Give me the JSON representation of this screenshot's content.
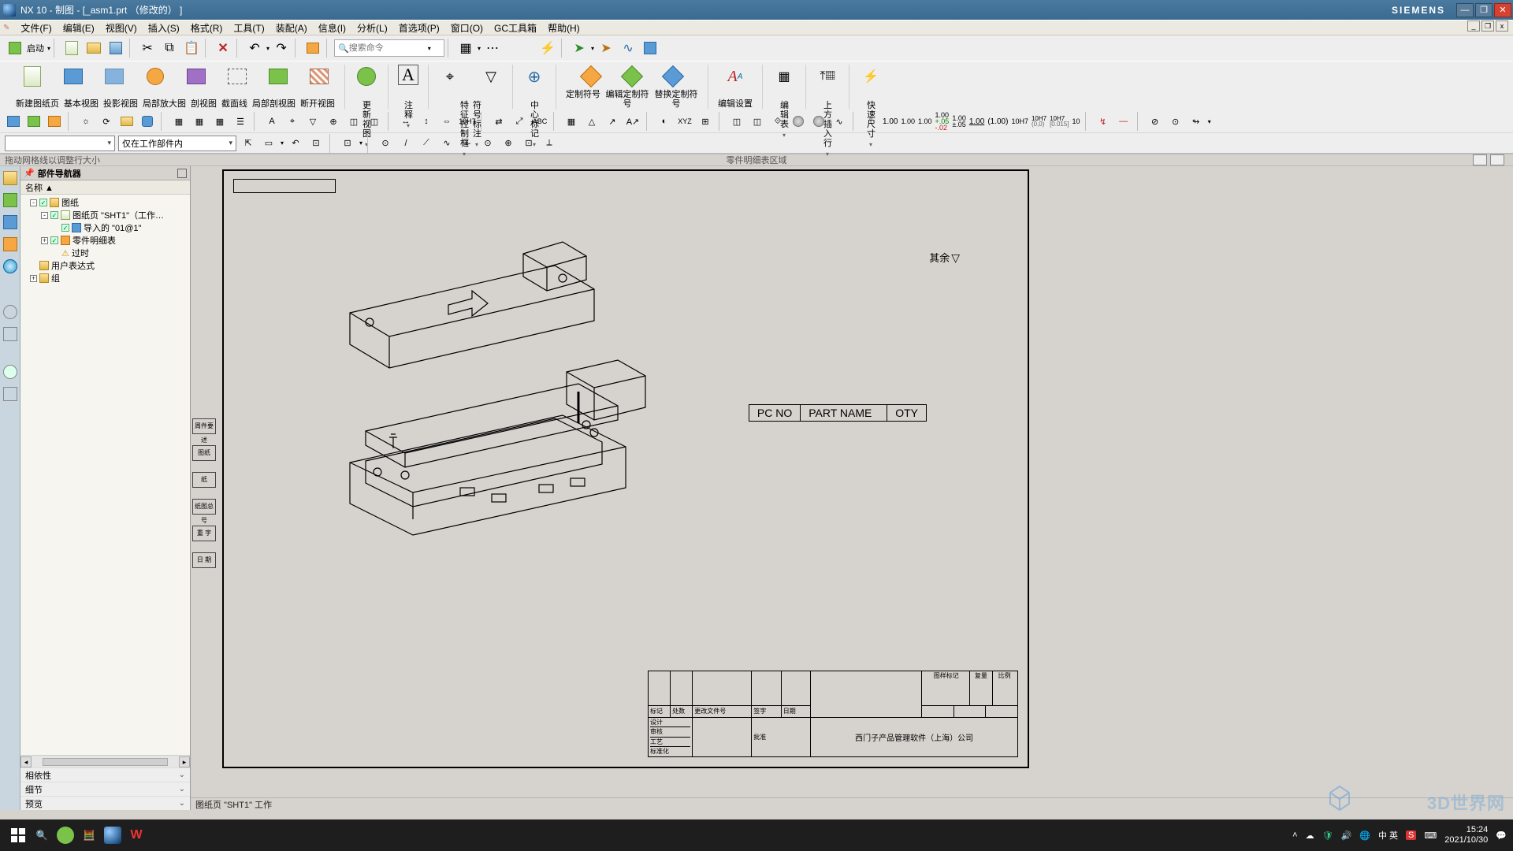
{
  "window": {
    "title": "NX 10 - 制图 - [_asm1.prt （修改的） ]",
    "brand": "SIEMENS"
  },
  "menu": {
    "items": [
      "文件(F)",
      "编辑(E)",
      "视图(V)",
      "插入(S)",
      "格式(R)",
      "工具(T)",
      "装配(A)",
      "信息(I)",
      "分析(L)",
      "首选项(P)",
      "窗口(O)",
      "GC工具箱",
      "帮助(H)"
    ]
  },
  "toolbar1": {
    "start": "启动",
    "searchPlaceholder": "搜索命令"
  },
  "ribbon": {
    "groups": [
      {
        "items": [
          {
            "icon": "new-sheet",
            "label": "新建图纸页"
          },
          {
            "icon": "base-view",
            "label": "基本视图"
          },
          {
            "icon": "proj-view",
            "label": "投影视图"
          },
          {
            "icon": "detail-view",
            "label": "局部放大图"
          },
          {
            "icon": "section-view",
            "label": "剖视图"
          },
          {
            "icon": "section-line",
            "label": "截面线"
          },
          {
            "icon": "local-section",
            "label": "局部剖视图"
          },
          {
            "icon": "break-view",
            "label": "断开视图"
          }
        ]
      },
      {
        "items": [
          {
            "icon": "update-view",
            "label": "更新视图",
            "drop": true
          }
        ]
      },
      {
        "items": [
          {
            "icon": "note",
            "label": "注释",
            "drop": true
          }
        ]
      },
      {
        "items": [
          {
            "icon": "feature-ctrl",
            "label": "特征控制框",
            "drop": true
          },
          {
            "icon": "symbol",
            "label": "符号标注",
            "drop": true
          }
        ]
      },
      {
        "items": [
          {
            "icon": "center-mark",
            "label": "中心标记",
            "drop": true
          }
        ]
      },
      {
        "items": [
          {
            "icon": "custom-sym",
            "label": "定制符号"
          },
          {
            "icon": "edit-custom",
            "label": "编辑定制符号"
          },
          {
            "icon": "swap-custom",
            "label": "替换定制符号"
          }
        ]
      },
      {
        "items": [
          {
            "icon": "edit-settings",
            "label": "编辑设置"
          }
        ]
      },
      {
        "items": [
          {
            "icon": "edit-table",
            "label": "编辑表",
            "drop": true
          }
        ]
      },
      {
        "items": [
          {
            "icon": "insert-above",
            "label": "上方插入行",
            "drop": true
          }
        ]
      },
      {
        "items": [
          {
            "icon": "quick-dim",
            "label": "快速尺寸",
            "drop": true
          }
        ]
      }
    ]
  },
  "toolRow3": {
    "textLabels": [
      "1.00",
      "10H7",
      "ABC",
      "XYZ",
      "1.00",
      "1.00",
      "1.00",
      "1.00",
      "1.00",
      "1.00",
      "(1.00)",
      "10H7",
      "10H7",
      "10H7",
      "10"
    ]
  },
  "toolRow4": {
    "combo1": "",
    "combo2": "仅在工作部件内"
  },
  "grip": {
    "left": "拖动网格线以调整行大小",
    "center": "零件明细表区域"
  },
  "navigator": {
    "title": "部件导航器",
    "colhdr": "名称    ▲",
    "tree": [
      {
        "level": 1,
        "pm": "-",
        "chk": true,
        "icon": "folder",
        "label": "图纸"
      },
      {
        "level": 2,
        "pm": "-",
        "chk": true,
        "icon": "sheet",
        "label": "图纸页 \"SHT1\"（工作…"
      },
      {
        "level": 3,
        "pm": "",
        "chk": true,
        "icon": "import",
        "label": "导入的 \"01@1\""
      },
      {
        "level": 2,
        "pm": "+",
        "chk": true,
        "icon": "list",
        "label": "零件明细表"
      },
      {
        "level": 3,
        "pm": "",
        "chk": false,
        "icon": "warn",
        "label": "过时"
      },
      {
        "level": 1,
        "pm": "",
        "chk": false,
        "icon": "folder",
        "label": "用户表达式"
      },
      {
        "level": 1,
        "pm": "+",
        "chk": false,
        "icon": "folder",
        "label": "组"
      }
    ],
    "bottom": [
      "相依性",
      "细节",
      "预览"
    ]
  },
  "canvas": {
    "annotation": "其余",
    "partsHeader": {
      "c1": "PC NO",
      "c2": "PART NAME",
      "c3": "OTY"
    },
    "leftCells": [
      "周件要述",
      "图纸",
      "纸",
      "纸图总号",
      "重 字",
      "日 期"
    ],
    "titleBlock": {
      "company": "西门子产品管理软件（上海）公司",
      "hdr1": "图样标记",
      "hdr2": "复量",
      "hdr3": "比例",
      "r1": "标记",
      "r2": "处数",
      "r3": "更改文件号",
      "r4": "签字",
      "r5": "日期",
      "a1": "设计",
      "a2": "标准化",
      "a3": "审核",
      "a4": "工艺",
      "a5": "批准"
    },
    "status": "图纸页 \"SHT1\" 工作"
  },
  "taskbar": {
    "ime": "中 英",
    "time": "15:24",
    "date": "2021/10/30"
  },
  "watermark": "3D世界网"
}
